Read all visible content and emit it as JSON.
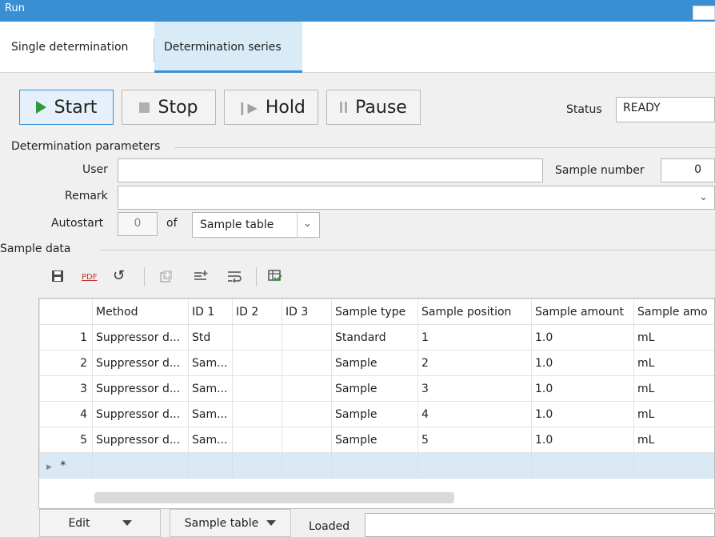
{
  "window": {
    "title": "Run"
  },
  "tabs": [
    {
      "label": "Single determination"
    },
    {
      "label": "Determination series"
    }
  ],
  "toolbar": {
    "start": "Start",
    "stop": "Stop",
    "hold": "Hold",
    "pause": "Pause"
  },
  "status": {
    "label": "Status",
    "value": "READY"
  },
  "params": {
    "header": "Determination parameters",
    "user_label": "User",
    "user_value": "",
    "sample_number_label": "Sample number",
    "sample_number_value": "0",
    "remark_label": "Remark",
    "remark_value": "",
    "autostart_label": "Autostart",
    "autostart_value": "0",
    "of_label": "of",
    "autostart_source": "Sample table"
  },
  "sample_data": {
    "header": "Sample data",
    "toolbar_icons": [
      "save-icon",
      "pdf-icon",
      "undo-icon",
      "add-copy-icon",
      "insert-row-icon",
      "wrap-icon",
      "table-check-icon"
    ],
    "pdf_label": "PDF",
    "columns": [
      "",
      "Method",
      "ID 1",
      "ID 2",
      "ID 3",
      "Sample type",
      "Sample position",
      "Sample amount",
      "Sample amo"
    ],
    "rows": [
      [
        "1",
        "Suppressor d...",
        "Std",
        "",
        "",
        "Standard",
        "1",
        "1.0",
        "mL"
      ],
      [
        "2",
        "Suppressor d...",
        "Sam...",
        "",
        "",
        "Sample",
        "2",
        "1.0",
        "mL"
      ],
      [
        "3",
        "Suppressor d...",
        "Sam...",
        "",
        "",
        "Sample",
        "3",
        "1.0",
        "mL"
      ],
      [
        "4",
        "Suppressor d...",
        "Sam...",
        "",
        "",
        "Sample",
        "4",
        "1.0",
        "mL"
      ],
      [
        "5",
        "Suppressor d...",
        "Sam...",
        "",
        "",
        "Sample",
        "5",
        "1.0",
        "mL"
      ]
    ],
    "new_row_marker": "*"
  },
  "bottom": {
    "edit_label": "Edit",
    "table_label": "Sample table",
    "loaded_label": "Loaded",
    "loaded_value": ""
  },
  "colors": {
    "accent": "#3a8fd3",
    "start_icon": "#2e9a3c",
    "selected_row": "#dbe9f5"
  }
}
